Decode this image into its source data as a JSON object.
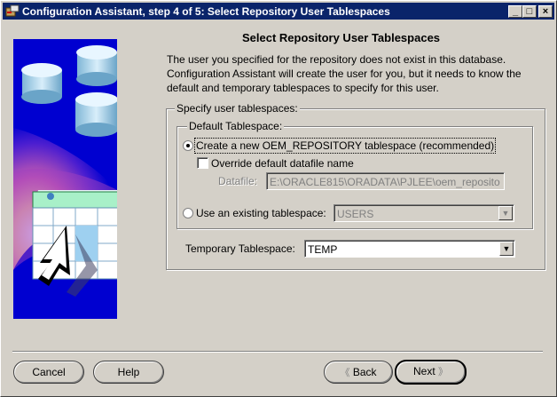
{
  "window": {
    "title": "Configuration Assistant, step 4 of 5: Select Repository User Tablespaces",
    "controls": {
      "minimize": "_",
      "maximize": "□",
      "close": "×"
    }
  },
  "page": {
    "heading": "Select Repository User Tablespaces",
    "intro_lines": [
      "The user you specified for the repository does not exist in this database.",
      "Configuration Assistant will create the user for you, but it needs to know the",
      "default and temporary tablespaces to specify for this user."
    ]
  },
  "tablespaces": {
    "legend": "Specify user tablespaces:",
    "default": {
      "legend": "Default Tablespace:",
      "create_new_label": "Create a new OEM_REPOSITORY tablespace (recommended)",
      "create_new_selected": true,
      "override_label": "Override default datafile name",
      "override_checked": false,
      "datafile_label": "Datafile:",
      "datafile_value": "E:\\ORACLE815\\ORADATA\\PJLEE\\oem_reposito",
      "use_existing_label": "Use an existing tablespace:",
      "use_existing_selected": false,
      "existing_value": "USERS"
    },
    "temporary": {
      "label": "Temporary Tablespace:",
      "value": "TEMP"
    }
  },
  "buttons": {
    "cancel": "Cancel",
    "help": "Help",
    "back": "Back",
    "next": "Next"
  },
  "icons": {
    "title": "config-assistant-icon",
    "dropdown": "chevron-down-icon",
    "back": "double-chevron-left-icon",
    "next": "double-chevron-right-icon"
  }
}
